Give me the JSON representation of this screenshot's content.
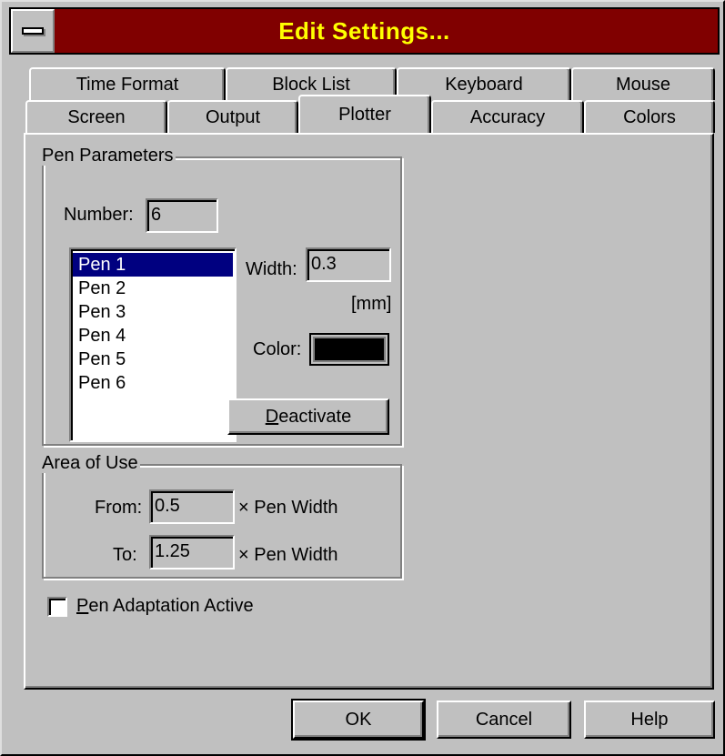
{
  "window": {
    "title": "Edit Settings..."
  },
  "tabs": {
    "row1": [
      "Time Format",
      "Block List",
      "Keyboard",
      "Mouse"
    ],
    "row2": [
      "Screen",
      "Output",
      "Plotter",
      "Accuracy",
      "Colors"
    ],
    "active": "Plotter"
  },
  "pen_parameters": {
    "group_label": "Pen Parameters",
    "number_label": "Number:",
    "number_value": "6",
    "pens": [
      "Pen 1",
      "Pen 2",
      "Pen 3",
      "Pen 4",
      "Pen 5",
      "Pen 6"
    ],
    "selected_pen": "Pen 1",
    "width_label": "Width:",
    "width_value": "0.3",
    "width_unit": "[mm]",
    "color_label": "Color:",
    "color_value": "#000000",
    "deactivate_first": "D",
    "deactivate_rest": "eactivate"
  },
  "area_of_use": {
    "group_label": "Area of Use",
    "from_label": "From:",
    "from_value": "0.5",
    "to_label": "To:",
    "to_value": "1.25",
    "suffix": "× Pen Width"
  },
  "pen_adaptation": {
    "first": "P",
    "rest": "en Adaptation Active",
    "checked": false
  },
  "buttons": {
    "ok": "OK",
    "cancel": "Cancel",
    "help": "Help"
  }
}
